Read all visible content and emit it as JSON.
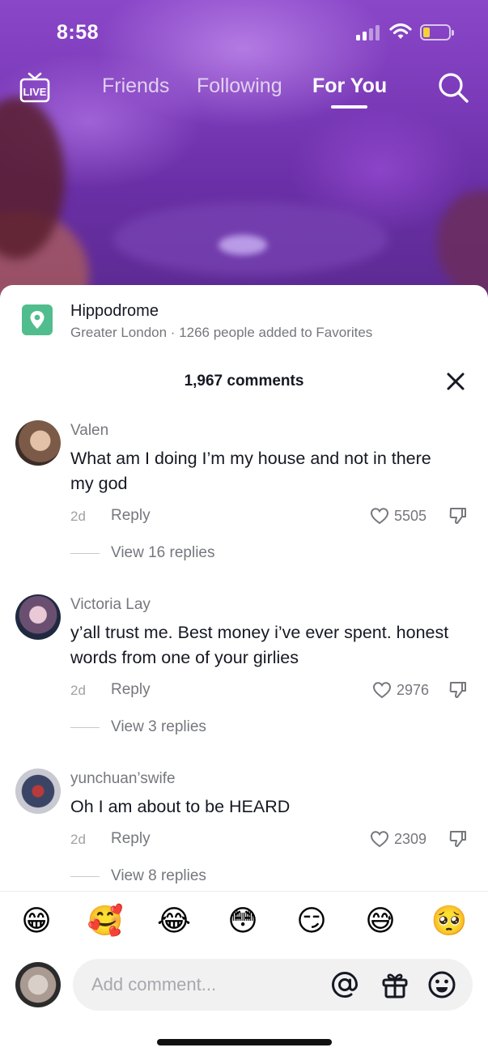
{
  "status_bar": {
    "time": "8:58",
    "icons": [
      "cellular-signal-icon",
      "wifi-icon",
      "battery-icon"
    ],
    "battery_level": 0.25,
    "battery_color": "#f4d13b"
  },
  "top_nav": {
    "live_label": "LIVE",
    "tabs": [
      {
        "label": "Friends",
        "active": false
      },
      {
        "label": "Following",
        "active": false
      },
      {
        "label": "For You",
        "active": true
      }
    ],
    "search_icon": "search-icon"
  },
  "location": {
    "icon": "location-pin-icon",
    "name": "Hippodrome",
    "subtitle": "Greater London · 1266 people added to Favorites",
    "accent": "#51bd8e"
  },
  "comments_header": {
    "count_label": "1,967 comments",
    "close_icon": "close-icon"
  },
  "comments": [
    {
      "username": "Valen",
      "text": "What am I doing I’m my house and not in there my god",
      "age": "2d",
      "reply_label": "Reply",
      "likes": "5505",
      "view_replies": "View 16 replies"
    },
    {
      "username": "Victoria Lay",
      "text": "y’all trust me. Best money i’ve ever spent. honest words from one of your girlies",
      "age": "2d",
      "reply_label": "Reply",
      "likes": "2976",
      "view_replies": "View 3 replies"
    },
    {
      "username": "yunchuan’swife",
      "text": "Oh I am about to be HEARD",
      "age": "2d",
      "reply_label": "Reply",
      "likes": "2309",
      "view_replies": "View 8 replies"
    }
  ],
  "emoji_bar": [
    "😁",
    "🥰",
    "😂",
    "😳",
    "😏",
    "😅",
    "🥺"
  ],
  "composer": {
    "placeholder": "Add comment...",
    "icons": [
      "at-mention-icon",
      "gift-icon",
      "emoji-icon"
    ]
  }
}
